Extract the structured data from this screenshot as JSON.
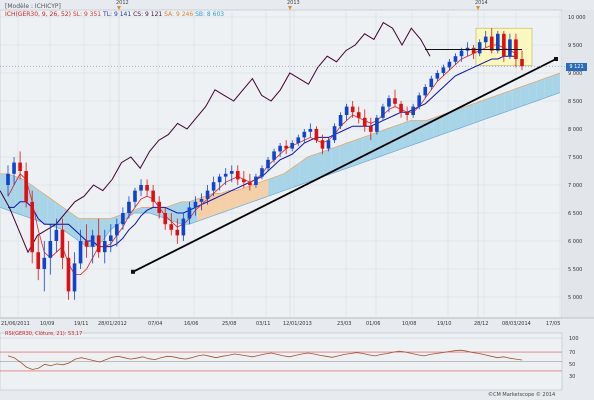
{
  "header": {
    "module_label": "[Modèle : ICHICYP]",
    "indicator_line": {
      "name": "ICH(GER30, 9, 26, 52)",
      "sl": "SL: 9 351",
      "tl": "TL: 9 141",
      "cs": "CS: 9 121",
      "sa": "SA: 9 246",
      "sb": "SB: 8 603"
    }
  },
  "top_years": [
    "2012",
    "2013",
    "2014"
  ],
  "price_axis_labels": [
    "10 000",
    "9 500",
    "9 000",
    "8 500",
    "8 000",
    "7 500",
    "7 000",
    "6 500",
    "6 000",
    "5 500",
    "5 000"
  ],
  "current_price_label": "9 121",
  "date_axis_labels": [
    "21/06/2011",
    "10/09",
    "19/11",
    "28/01/2012",
    "07/04",
    "16/06",
    "25/08",
    "03/11",
    "12/01/2013",
    "23/03",
    "01/06",
    "10/08",
    "19/10",
    "28/12",
    "08/03/2014",
    "17/05"
  ],
  "rsi_panel": {
    "label": "RSI(GER30, Clôture, 21): 53,17",
    "levels": [
      "100",
      "70",
      "50",
      "30"
    ]
  },
  "copyright": "©CM Marketscope © 2014",
  "colors": {
    "background": "#e7ebef",
    "kumo_bull": "#a8d4e8",
    "kumo_bear": "#f5cfa8",
    "candle_up": "#1144cc",
    "candle_down": "#dd1111",
    "kijun": "#1111aa",
    "tenkan": "#dd2222",
    "chikou": "#440033",
    "trendline": "#000000",
    "highlight_box": "#fbf7c0",
    "rsi_line": "#a0522d",
    "rsi_level": "#e05050"
  },
  "chart_data": {
    "type": "candlestick",
    "symbol": "GER30",
    "y_axis_range": [
      4800,
      10150
    ],
    "candles": [
      {
        "o": 7000,
        "h": 7350,
        "l": 6800,
        "c": 7200
      },
      {
        "o": 7200,
        "h": 7500,
        "l": 7000,
        "c": 7400
      },
      {
        "o": 7400,
        "h": 7600,
        "l": 7100,
        "c": 7250
      },
      {
        "o": 7250,
        "h": 7400,
        "l": 6600,
        "c": 6700
      },
      {
        "o": 6700,
        "h": 6900,
        "l": 5600,
        "c": 5800
      },
      {
        "o": 5800,
        "h": 6100,
        "l": 5300,
        "c": 5500
      },
      {
        "o": 5500,
        "h": 6000,
        "l": 5100,
        "c": 5700
      },
      {
        "o": 5700,
        "h": 6300,
        "l": 5400,
        "c": 6000
      },
      {
        "o": 6000,
        "h": 6400,
        "l": 5800,
        "c": 6200
      },
      {
        "o": 6200,
        "h": 6400,
        "l": 5500,
        "c": 5700
      },
      {
        "o": 5700,
        "h": 6000,
        "l": 4950,
        "c": 5100
      },
      {
        "o": 5100,
        "h": 5800,
        "l": 4950,
        "c": 5600
      },
      {
        "o": 5600,
        "h": 6200,
        "l": 5500,
        "c": 6000
      },
      {
        "o": 6000,
        "h": 6300,
        "l": 5700,
        "c": 5900
      },
      {
        "o": 5900,
        "h": 6200,
        "l": 5600,
        "c": 6100
      },
      {
        "o": 6100,
        "h": 6400,
        "l": 5700,
        "c": 5800
      },
      {
        "o": 5800,
        "h": 6200,
        "l": 5600,
        "c": 6000
      },
      {
        "o": 6000,
        "h": 6300,
        "l": 5800,
        "c": 6100
      },
      {
        "o": 6100,
        "h": 6400,
        "l": 5900,
        "c": 6300
      },
      {
        "o": 6300,
        "h": 6600,
        "l": 6200,
        "c": 6500
      },
      {
        "o": 6500,
        "h": 6800,
        "l": 6400,
        "c": 6700
      },
      {
        "o": 6700,
        "h": 6950,
        "l": 6600,
        "c": 6900
      },
      {
        "o": 6900,
        "h": 7100,
        "l": 6800,
        "c": 7000
      },
      {
        "o": 7000,
        "h": 7100,
        "l": 6800,
        "c": 6900
      },
      {
        "o": 6900,
        "h": 7000,
        "l": 6600,
        "c": 6700
      },
      {
        "o": 6700,
        "h": 6800,
        "l": 6400,
        "c": 6500
      },
      {
        "o": 6500,
        "h": 6600,
        "l": 6200,
        "c": 6300
      },
      {
        "o": 6300,
        "h": 6500,
        "l": 6100,
        "c": 6200
      },
      {
        "o": 6200,
        "h": 6400,
        "l": 5950,
        "c": 6100
      },
      {
        "o": 6100,
        "h": 6500,
        "l": 6000,
        "c": 6400
      },
      {
        "o": 6400,
        "h": 6700,
        "l": 6300,
        "c": 6600
      },
      {
        "o": 6600,
        "h": 6800,
        "l": 6450,
        "c": 6700
      },
      {
        "o": 6700,
        "h": 6850,
        "l": 6550,
        "c": 6750
      },
      {
        "o": 6750,
        "h": 7000,
        "l": 6650,
        "c": 6900
      },
      {
        "o": 6900,
        "h": 7150,
        "l": 6800,
        "c": 7050
      },
      {
        "o": 7050,
        "h": 7200,
        "l": 6900,
        "c": 7150
      },
      {
        "o": 7150,
        "h": 7300,
        "l": 7000,
        "c": 7200
      },
      {
        "o": 7200,
        "h": 7350,
        "l": 7050,
        "c": 7250
      },
      {
        "o": 7250,
        "h": 7350,
        "l": 7000,
        "c": 7100
      },
      {
        "o": 7100,
        "h": 7250,
        "l": 6950,
        "c": 7050
      },
      {
        "o": 7050,
        "h": 7200,
        "l": 6900,
        "c": 7000
      },
      {
        "o": 7000,
        "h": 7200,
        "l": 6950,
        "c": 7150
      },
      {
        "o": 7150,
        "h": 7350,
        "l": 7100,
        "c": 7300
      },
      {
        "o": 7300,
        "h": 7500,
        "l": 7250,
        "c": 7450
      },
      {
        "o": 7450,
        "h": 7650,
        "l": 7400,
        "c": 7600
      },
      {
        "o": 7600,
        "h": 7750,
        "l": 7500,
        "c": 7700
      },
      {
        "o": 7700,
        "h": 7800,
        "l": 7550,
        "c": 7650
      },
      {
        "o": 7650,
        "h": 7800,
        "l": 7600,
        "c": 7750
      },
      {
        "o": 7750,
        "h": 7900,
        "l": 7700,
        "c": 7850
      },
      {
        "o": 7850,
        "h": 8000,
        "l": 7750,
        "c": 7950
      },
      {
        "o": 7950,
        "h": 8100,
        "l": 7850,
        "c": 8000
      },
      {
        "o": 8000,
        "h": 8050,
        "l": 7750,
        "c": 7800
      },
      {
        "o": 7800,
        "h": 7900,
        "l": 7550,
        "c": 7650
      },
      {
        "o": 7650,
        "h": 7850,
        "l": 7600,
        "c": 7800
      },
      {
        "o": 7800,
        "h": 8100,
        "l": 7750,
        "c": 8050
      },
      {
        "o": 8050,
        "h": 8300,
        "l": 8000,
        "c": 8250
      },
      {
        "o": 8250,
        "h": 8450,
        "l": 8150,
        "c": 8400
      },
      {
        "o": 8400,
        "h": 8500,
        "l": 8200,
        "c": 8300
      },
      {
        "o": 8300,
        "h": 8400,
        "l": 8100,
        "c": 8200
      },
      {
        "o": 8200,
        "h": 8350,
        "l": 7950,
        "c": 8050
      },
      {
        "o": 8050,
        "h": 8200,
        "l": 7800,
        "c": 7950
      },
      {
        "o": 7950,
        "h": 8250,
        "l": 7900,
        "c": 8200
      },
      {
        "o": 8200,
        "h": 8450,
        "l": 8150,
        "c": 8400
      },
      {
        "o": 8400,
        "h": 8600,
        "l": 8300,
        "c": 8550
      },
      {
        "o": 8550,
        "h": 8700,
        "l": 8400,
        "c": 8450
      },
      {
        "o": 8450,
        "h": 8500,
        "l": 8200,
        "c": 8300
      },
      {
        "o": 8300,
        "h": 8400,
        "l": 8150,
        "c": 8250
      },
      {
        "o": 8250,
        "h": 8450,
        "l": 8200,
        "c": 8400
      },
      {
        "o": 8400,
        "h": 8650,
        "l": 8350,
        "c": 8600
      },
      {
        "o": 8600,
        "h": 8800,
        "l": 8550,
        "c": 8750
      },
      {
        "o": 8750,
        "h": 8950,
        "l": 8700,
        "c": 8900
      },
      {
        "o": 8900,
        "h": 9050,
        "l": 8850,
        "c": 9000
      },
      {
        "o": 9000,
        "h": 9150,
        "l": 8950,
        "c": 9100
      },
      {
        "o": 9100,
        "h": 9250,
        "l": 9050,
        "c": 9200
      },
      {
        "o": 9200,
        "h": 9350,
        "l": 9150,
        "c": 9300
      },
      {
        "o": 9300,
        "h": 9450,
        "l": 9200,
        "c": 9400
      },
      {
        "o": 9400,
        "h": 9550,
        "l": 9300,
        "c": 9450
      },
      {
        "o": 9450,
        "h": 9500,
        "l": 9250,
        "c": 9350
      },
      {
        "o": 9350,
        "h": 9600,
        "l": 9300,
        "c": 9550
      },
      {
        "o": 9550,
        "h": 9750,
        "l": 9450,
        "c": 9650
      },
      {
        "o": 9650,
        "h": 9800,
        "l": 9350,
        "c": 9400
      },
      {
        "o": 9400,
        "h": 9750,
        "l": 9350,
        "c": 9700
      },
      {
        "o": 9700,
        "h": 9750,
        "l": 9200,
        "c": 9300
      },
      {
        "o": 9300,
        "h": 9700,
        "l": 9250,
        "c": 9600
      },
      {
        "o": 9600,
        "h": 9700,
        "l": 9100,
        "c": 9250
      },
      {
        "o": 9250,
        "h": 9400,
        "l": 9050,
        "c": 9121
      }
    ],
    "kijun_sen": [
      6600,
      6600,
      6700,
      6700,
      6600,
      6400,
      6300,
      6300,
      6300,
      6300,
      6300,
      6200,
      6100,
      6000,
      6000,
      5900,
      5900,
      5900,
      5950,
      6050,
      6200,
      6300,
      6450,
      6550,
      6600,
      6600,
      6600,
      6550,
      6500,
      6500,
      6550,
      6600,
      6650,
      6700,
      6750,
      6800,
      6850,
      6900,
      6950,
      7000,
      7050,
      7100,
      7150,
      7250,
      7350,
      7450,
      7500,
      7550,
      7650,
      7750,
      7800,
      7850,
      7850,
      7850,
      7900,
      7950,
      8000,
      8050,
      8050,
      8050,
      8050,
      8100,
      8150,
      8200,
      8250,
      8300,
      8300,
      8350,
      8400,
      8450,
      8550,
      8650,
      8750,
      8850,
      8950,
      9000,
      9050,
      9100,
      9150,
      9200,
      9250,
      9250,
      9300,
      9300,
      9300
    ],
    "tenkan_sen": [
      6800,
      7000,
      7200,
      7100,
      6700,
      6200,
      5800,
      5700,
      5800,
      5900,
      5600,
      5400,
      5400,
      5500,
      5700,
      5900,
      5900,
      5950,
      6100,
      6250,
      6450,
      6600,
      6750,
      6800,
      6750,
      6600,
      6450,
      6350,
      6250,
      6300,
      6400,
      6550,
      6650,
      6750,
      6850,
      6950,
      7050,
      7100,
      7150,
      7100,
      7050,
      7100,
      7200,
      7350,
      7450,
      7550,
      7650,
      7700,
      7750,
      7800,
      7850,
      7800,
      7750,
      7800,
      7900,
      8050,
      8150,
      8250,
      8200,
      8150,
      8100,
      8150,
      8250,
      8350,
      8400,
      8350,
      8300,
      8300,
      8400,
      8550,
      8700,
      8850,
      8950,
      9050,
      9150,
      9250,
      9300,
      9350,
      9400,
      9450,
      9500,
      9500,
      9450,
      9400,
      9350
    ],
    "chikou_span": [
      6900,
      6600,
      6200,
      5800,
      6100,
      6200,
      6300,
      6500,
      6700,
      6800,
      7000,
      6900,
      7100,
      7400,
      7500,
      7300,
      7600,
      7800,
      7900,
      8100,
      8000,
      8200,
      8400,
      8700,
      8600,
      8500,
      8700,
      8900,
      8600,
      8500,
      8700,
      9000,
      8900,
      8800,
      9100,
      9300,
      9200,
      9400,
      9500,
      9700,
      9600,
      9900,
      9800,
      9500,
      9800,
      9600,
      9300
    ],
    "kumo_upper": [
      7200,
      7200,
      7150,
      7100,
      7000,
      6900,
      6800,
      6700,
      6600,
      6500,
      6400,
      6400,
      6400,
      6400,
      6400,
      6450,
      6500,
      6550,
      6600,
      6600,
      6600,
      6600,
      6650,
      6700,
      6700,
      6750,
      6800,
      6850,
      6850,
      6900,
      6900,
      6950,
      7000,
      7050,
      7100,
      7150,
      7200,
      7300,
      7400,
      7500,
      7550,
      7600,
      7650,
      7700,
      7750,
      7800,
      7850,
      7900,
      7950,
      8000,
      8050,
      8100,
      8150,
      8150,
      8150,
      8200,
      8250,
      8300,
      8350,
      8400,
      8450,
      8500,
      8550,
      8600,
      8650,
      8700,
      8750,
      8800,
      8850,
      8900,
      8950,
      9000
    ],
    "kumo_lower": [
      6600,
      6550,
      6500,
      6450,
      6400,
      6350,
      6300,
      6250,
      6200,
      6100,
      6000,
      5900,
      5900,
      6000,
      6200,
      6300,
      6400,
      6500,
      6500,
      6500,
      6450,
      6400,
      6350,
      6300,
      6300,
      6350,
      6400,
      6450,
      6500,
      6550,
      6600,
      6650,
      6700,
      6750,
      6800,
      6850,
      6900,
      6950,
      7000,
      7050,
      7100,
      7150,
      7200,
      7250,
      7300,
      7350,
      7400,
      7450,
      7500,
      7550,
      7600,
      7650,
      7700,
      7750,
      7800,
      7850,
      7900,
      7950,
      8000,
      8050,
      8100,
      8150,
      8200,
      8250,
      8300,
      8350,
      8400,
      8450,
      8500,
      8550,
      8600,
      8650
    ],
    "trendline": {
      "start": 5450,
      "end": 9250
    },
    "horizontal_resistance": 9420,
    "rsi": {
      "values": [
        62,
        58,
        49,
        38,
        33,
        36,
        44,
        41,
        45,
        43,
        47,
        55,
        58,
        55,
        52,
        49,
        54,
        59,
        61,
        58,
        55,
        57,
        60,
        56,
        54,
        58,
        61,
        60,
        57,
        55,
        58,
        62,
        64,
        61,
        58,
        61,
        63,
        66,
        64,
        62,
        60,
        63,
        66,
        68,
        65,
        62,
        60,
        63,
        66,
        68,
        66,
        63,
        61,
        59,
        62,
        65,
        67,
        69,
        67,
        64,
        62,
        65,
        67,
        70,
        72,
        70,
        67,
        64,
        62,
        65,
        67,
        69,
        71,
        73,
        74,
        72,
        69,
        67,
        64,
        61,
        58,
        60,
        57,
        55,
        53.17
      ],
      "levels": [
        100,
        70,
        50,
        30
      ]
    }
  }
}
